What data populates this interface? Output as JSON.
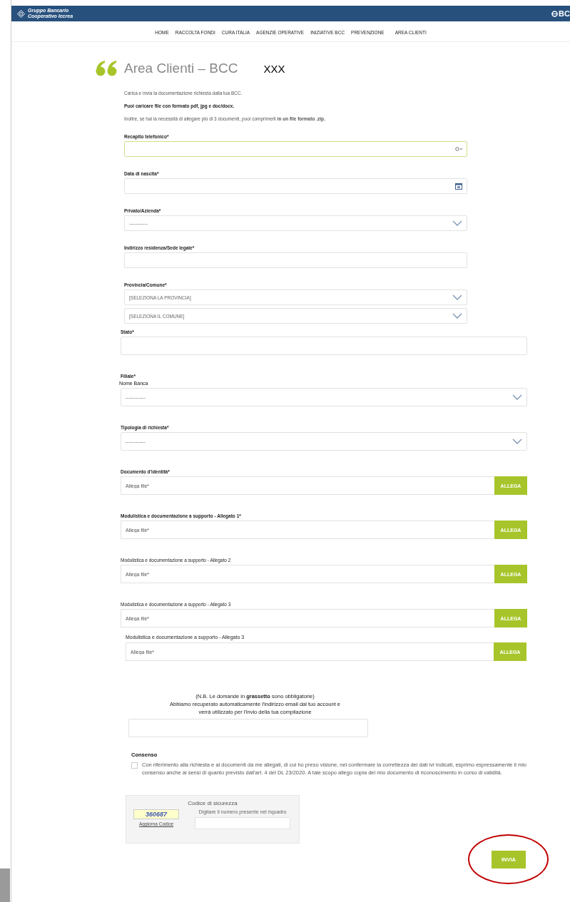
{
  "header": {
    "brand_lines": [
      "Gruppo Bancario",
      "Cooperativo Iccrea"
    ],
    "right_logo": "BC"
  },
  "nav": [
    "HOME",
    "RACCOLTA FONDI",
    "CURA ITALIA",
    "AGENZIE OPERATIVE",
    "INIZIATIVE BCC",
    "PREVENZIONE",
    "AREA CLIENTI"
  ],
  "page_title": "Area Clienti – BCC",
  "title_note": "XXX",
  "intro": [
    {
      "text": "Carica e invia la documentazione richiesta dalla tua BCC.",
      "bold": false
    },
    {
      "text": "Puoi caricare file con formato pdf, jpg e doc/docx.",
      "bold": true
    },
    {
      "text": "Inoltre, se hai la necessità di allegare più di 3 documenti, puoi comprimerli **in un file formato .zip.**",
      "bold": false
    }
  ],
  "fields_top": [
    {
      "kind": "phone",
      "label": "Recapito telefonico*",
      "bold": true,
      "focused": true
    },
    {
      "kind": "date",
      "label": "Data di nascita*",
      "bold": true,
      "focused": false
    },
    {
      "kind": "select",
      "label": "Privato/Azienda*",
      "bold": true,
      "focused": false,
      "options_shown": [
        "------------"
      ]
    },
    {
      "kind": "text",
      "label": "Indirizzo residenza/Sede legale*",
      "bold": true,
      "focused": false
    },
    {
      "kind": "select",
      "label": "Provincia/Comune*",
      "bold": true,
      "focused": false,
      "options_shown": [
        "[SELEZIONA LA PROVINCIA]",
        "[SELEZIONA IL COMUNE]"
      ]
    }
  ],
  "fields_bottom": [
    {
      "kind": "text",
      "label": "Stato*",
      "bold": true
    },
    {
      "kind": "select",
      "label": "Filiale*",
      "bold": true,
      "note": "Nome Banca",
      "options_shown": [
        "------------"
      ]
    },
    {
      "kind": "select",
      "label": "Tipologia di richiesta*",
      "bold": true,
      "options_shown": [
        "------------"
      ]
    },
    {
      "kind": "upload",
      "label": "Documento d'identità*",
      "bold": true,
      "placeholder": "Allega file*",
      "button": "ALLEGA"
    },
    {
      "kind": "upload",
      "label": "Modulistica e documentazione a supporto - Allegato 1*",
      "bold": true,
      "placeholder": "Allega file*",
      "button": "ALLEGA"
    },
    {
      "kind": "upload",
      "label": "Modulistica e documentazione a supporto - Allegato 2",
      "bold": false,
      "placeholder": "Allega file*",
      "button": "ALLEGA"
    },
    {
      "kind": "upload",
      "label": "Modulistica e documentazione a supporto - Allegato 3",
      "bold": false,
      "placeholder": "Allega file*",
      "button": "ALLEGA"
    }
  ],
  "extra_upload": {
    "label": "Modulistica e documentazione a supporto - Allegato 3",
    "placeholder": "Allega file*",
    "button": "ALLEGA"
  },
  "notes": [
    "(N.B. Le domande in **grassetto** sono obbligatorie)",
    "Abbiamo recuperato automaticamente l'indirizzo email dal tuo account e verrà utilizzato per l'invio della tua compilazione"
  ],
  "consent": {
    "title": "Consenso",
    "checked": false,
    "text": "Con riferimento alla richiesta e ai documenti da me allegati, di cui ho preso visione, nel confermare la correttezza dei dati ivi indicati, esprimo espressamente il mio consenso anche ai sensi di quanto previsto dall'art. 4 del DL 23/2020. A tale scopo allego copia del mio documento di riconoscimento in corso di validità."
  },
  "captcha": {
    "title": "Codice di sicurezza",
    "code": "360687",
    "refresh_link": "Aggiorna Codice",
    "hint": "Digitare il numero presente nel riquadro"
  },
  "submit": {
    "label": "INVIA",
    "annotated": true
  }
}
